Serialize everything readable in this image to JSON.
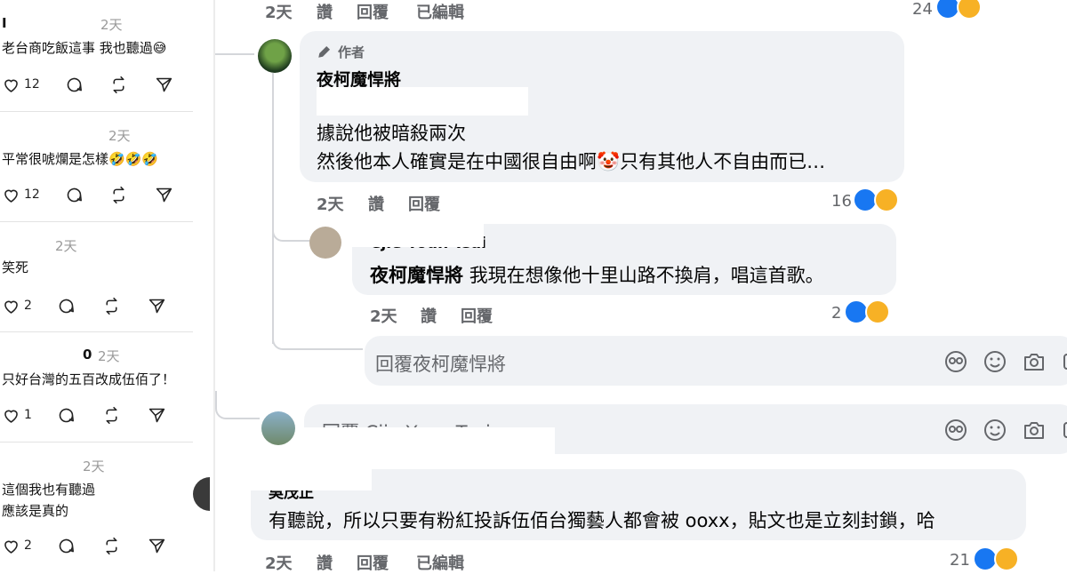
{
  "left_posts": [
    {
      "handle": "I",
      "time": "2天",
      "text": "老台商吃飯這事 我也聽過😅",
      "likes": "12",
      "show_handle": true
    },
    {
      "handle": "",
      "time": "2天",
      "text": "平常很唬爛是怎樣🤣🤣🤣",
      "likes": "12"
    },
    {
      "handle": "",
      "time": "2天",
      "text": "笑死",
      "likes": "2"
    },
    {
      "handle": "0",
      "time": "2天",
      "text": "只好台灣的五百改成伍佰了！",
      "likes": "1"
    },
    {
      "handle": "",
      "time": "2天",
      "text": "這個我也有聽過\n應該是真的",
      "likes": "2"
    }
  ],
  "top_meta": {
    "time": "2天",
    "like": "讚",
    "reply": "回覆",
    "edited": "已編輯",
    "reactions": "24"
  },
  "comment_main": {
    "badge": "作者",
    "author": "夜柯魔悍將",
    "text_line1": "據說他被暗殺兩次",
    "text_line2": "然後他本人確實是在中國很自由啊🤡只有其他人不自由而已…",
    "time": "2天",
    "like": "讚",
    "reply": "回覆",
    "reactions": "16"
  },
  "comment_reply": {
    "author": "Cjie Youn Tsai",
    "mention": "夜柯魔悍將",
    "text": "我現在想像他十里山路不換肩，唱這首歌。",
    "time": "2天",
    "like": "讚",
    "reply": "回覆",
    "reactions": "2"
  },
  "composer_1": {
    "placeholder": "回覆夜柯魔悍將"
  },
  "composer_2": {
    "placeholder": "回覆 Cjie Youn Tsai"
  },
  "comment_bottom": {
    "author": "吳茂正",
    "text": "有聽說，所以只要有粉紅投訴伍佰台獨藝人都會被 ooxx，貼文也是立刻封鎖，哈",
    "time": "2天",
    "like": "讚",
    "reply": "回覆",
    "edited": "已編輯",
    "reactions": "21"
  },
  "colors": {
    "bubble": "#f0f2f5",
    "meta": "#65676b",
    "like_blue": "#1877f2",
    "haha_yellow": "#f7b125"
  }
}
